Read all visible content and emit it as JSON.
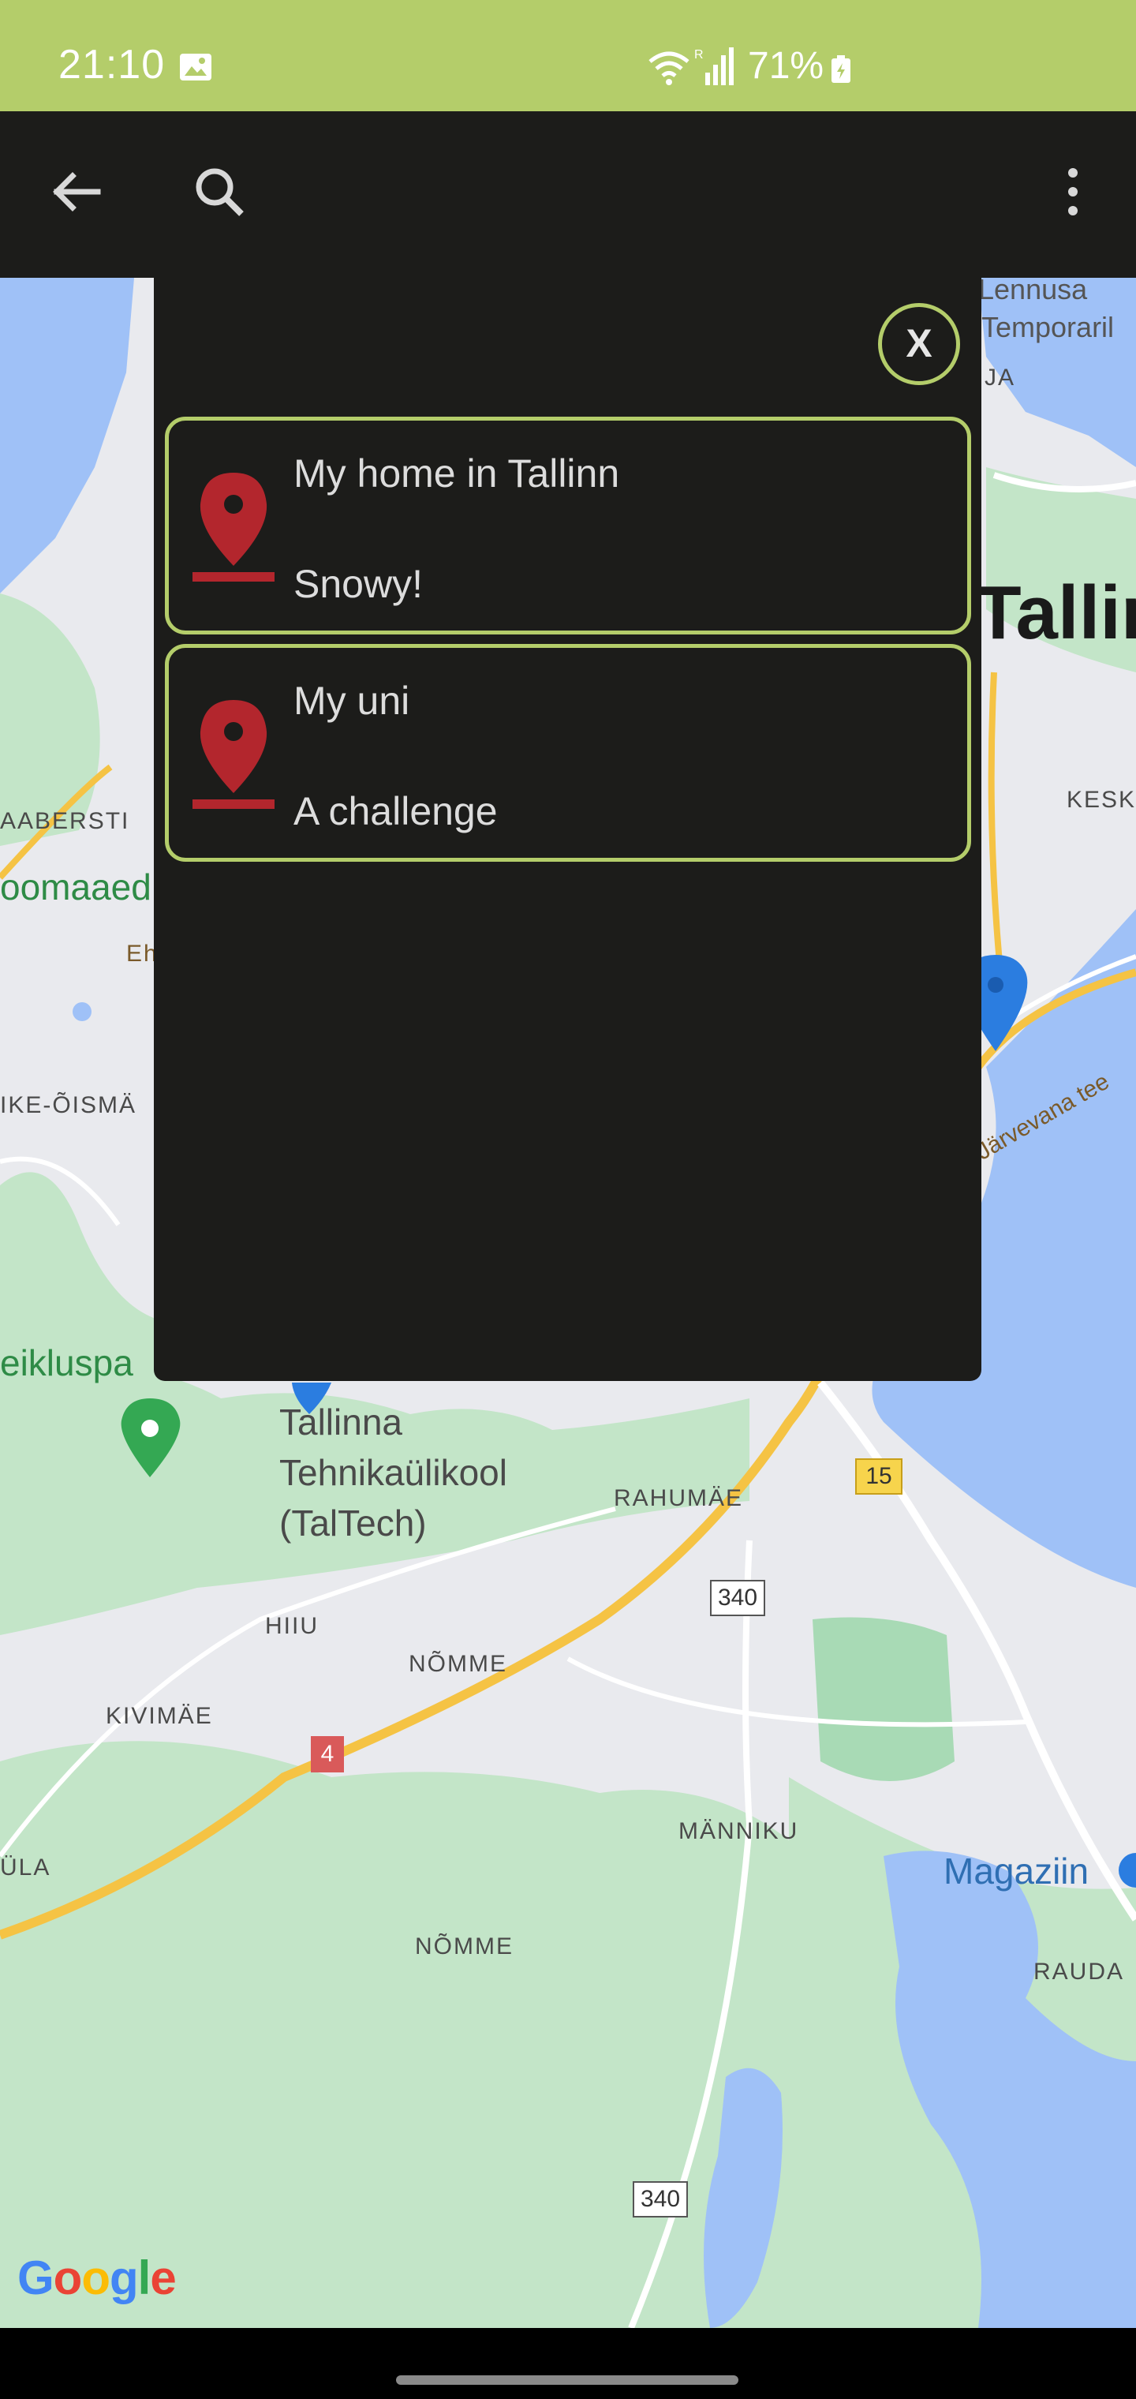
{
  "status_bar": {
    "time": "21:10",
    "battery": "71%",
    "icons": [
      "gallery-icon",
      "wifi-icon",
      "signal-icon",
      "battery-icon"
    ]
  },
  "toolbar": {
    "icons": [
      "back-arrow-icon",
      "search-icon",
      "more-vert-icon"
    ]
  },
  "map": {
    "labels": {
      "lennusadam": "Lennusa",
      "temporary": "Temporaril",
      "ja": "JA",
      "tallinn": "Tallin",
      "kesk": "KESK",
      "kaabersti": "AABERSTI",
      "toomaaed": "oomaaed",
      "ehitajate": "Eh",
      "haabersti_oismae": "IKE-ÕISMÄ",
      "jarvevana": "Järvevana tee",
      "spordipark": "eikluspa",
      "taltech_line1": "Tallinna",
      "taltech_line2": "Tehnikaülikool",
      "taltech_line3": "(TalTech)",
      "rahumae": "RAHUMÄE",
      "hiiu": "HIIU",
      "nomme1": "NÕMME",
      "kivimae": "KIVIMÄE",
      "ula": "ÜLA",
      "manniku": "MÄNNIKU",
      "magaziin": "Magaziin",
      "nomme2": "NÕMME",
      "rauda": "RAUDA"
    },
    "shields": {
      "road15": "15",
      "road340a": "340",
      "road4": "4",
      "road340b": "340"
    },
    "attribution": "Google",
    "attribution_colors": [
      "#4285F4",
      "#EA4335",
      "#FBBC05",
      "#4285F4",
      "#34A853",
      "#EA4335"
    ]
  },
  "dialog": {
    "close_label": "X",
    "places": [
      {
        "name": "My home in Tallinn",
        "description": "Snowy!",
        "icon": "map-pin-icon"
      },
      {
        "name": "My uni",
        "description": "A challenge",
        "icon": "map-pin-icon"
      }
    ]
  },
  "colors": {
    "accent": "#b4cd6a",
    "background": "#1c1c1a",
    "pin": "#b3262d",
    "text": "#dcdcdc"
  }
}
